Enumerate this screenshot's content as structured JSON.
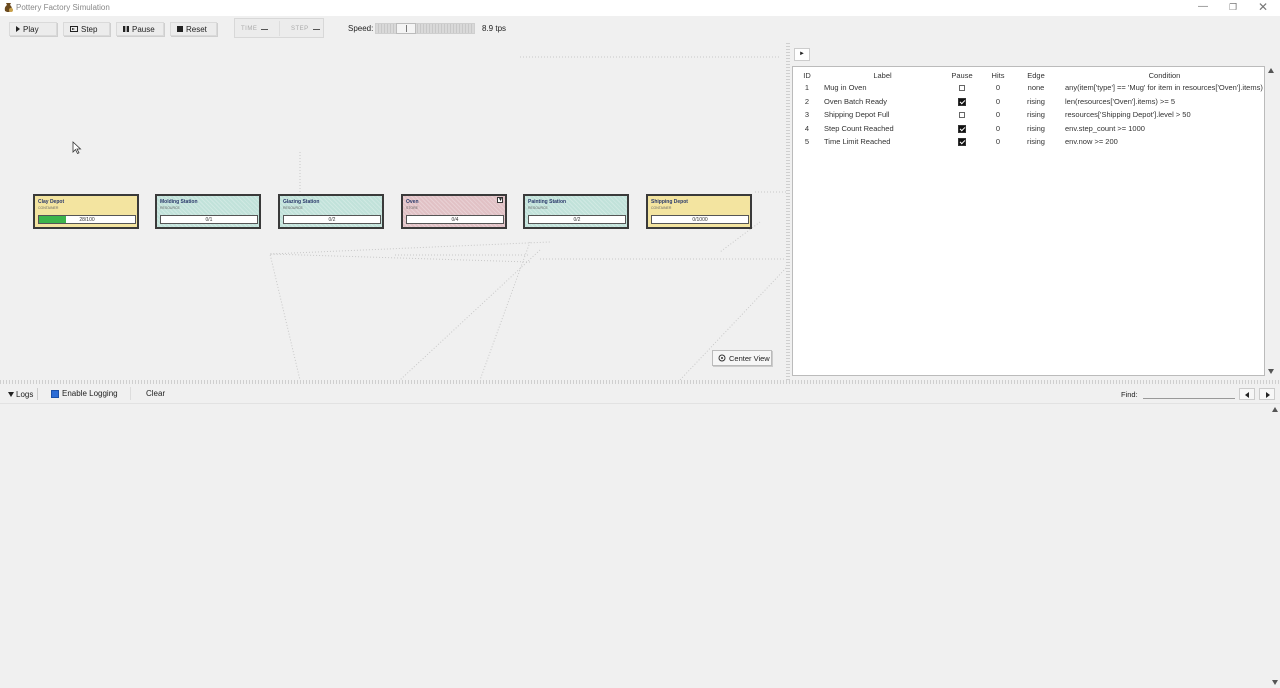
{
  "window": {
    "title": "Pottery Factory Simulation",
    "minimize": "—",
    "maximize": "❐",
    "close": "✕"
  },
  "toolbar": {
    "play": "Play",
    "step": "Step",
    "pause": "Pause",
    "reset": "Reset",
    "time_label": "TIME",
    "step_label": "STEP",
    "speed_label": "Speed:",
    "speed_value": "8.9 tps",
    "speed_fraction": 0.25
  },
  "canvas": {
    "nodes": [
      {
        "title": "Clay Depot",
        "subtitle": "CONTAINER",
        "value": "28/100",
        "fill": 0.28,
        "color": "yellow"
      },
      {
        "title": "Molding Station",
        "subtitle": "RESOURCE",
        "value": "0/1",
        "fill": 0,
        "color": "teal"
      },
      {
        "title": "Glazing Station",
        "subtitle": "RESOURCE",
        "value": "0/2",
        "fill": 0,
        "color": "teal"
      },
      {
        "title": "Oven",
        "subtitle": "STORE",
        "value": "0/4",
        "fill": 0,
        "color": "pink",
        "marker": "▼"
      },
      {
        "title": "Painting Station",
        "subtitle": "RESOURCE",
        "value": "0/2",
        "fill": 0,
        "color": "teal"
      },
      {
        "title": "Shipping Depot",
        "subtitle": "CONTAINER",
        "value": "0/1000",
        "fill": 0,
        "color": "yellow"
      }
    ],
    "center_view": "Center View"
  },
  "breakpoints": {
    "toggle": "►",
    "columns": {
      "id": "ID",
      "label": "Label",
      "pause": "Pause",
      "hits": "Hits",
      "edge": "Edge",
      "condition": "Condition"
    },
    "rows": [
      {
        "id": "1",
        "label": "Mug in Oven",
        "pause": false,
        "hits": "0",
        "edge": "none",
        "condition": "any(item['type'] == 'Mug' for item in resources['Oven'].items)"
      },
      {
        "id": "2",
        "label": "Oven Batch Ready",
        "pause": true,
        "hits": "0",
        "edge": "rising",
        "condition": "len(resources['Oven'].items) >= 5"
      },
      {
        "id": "3",
        "label": "Shipping Depot Full",
        "pause": false,
        "hits": "0",
        "edge": "rising",
        "condition": "resources['Shipping Depot'].level > 50"
      },
      {
        "id": "4",
        "label": "Step Count Reached",
        "pause": true,
        "hits": "0",
        "edge": "rising",
        "condition": "env.step_count >= 1000"
      },
      {
        "id": "5",
        "label": "Time Limit Reached",
        "pause": true,
        "hits": "0",
        "edge": "rising",
        "condition": "env.now >= 200"
      }
    ]
  },
  "logs": {
    "toggle": "Logs",
    "enable_logging": "Enable Logging",
    "enable_checked": true,
    "clear": "Clear",
    "find_label": "Find:",
    "find_value": ""
  },
  "colors": {
    "yellow": "#f3e4a0",
    "teal": "#c1e2da",
    "pink": "#e1c1c5",
    "progress": "#3cb44b",
    "checkbox_accent": "#2b6cd6"
  }
}
